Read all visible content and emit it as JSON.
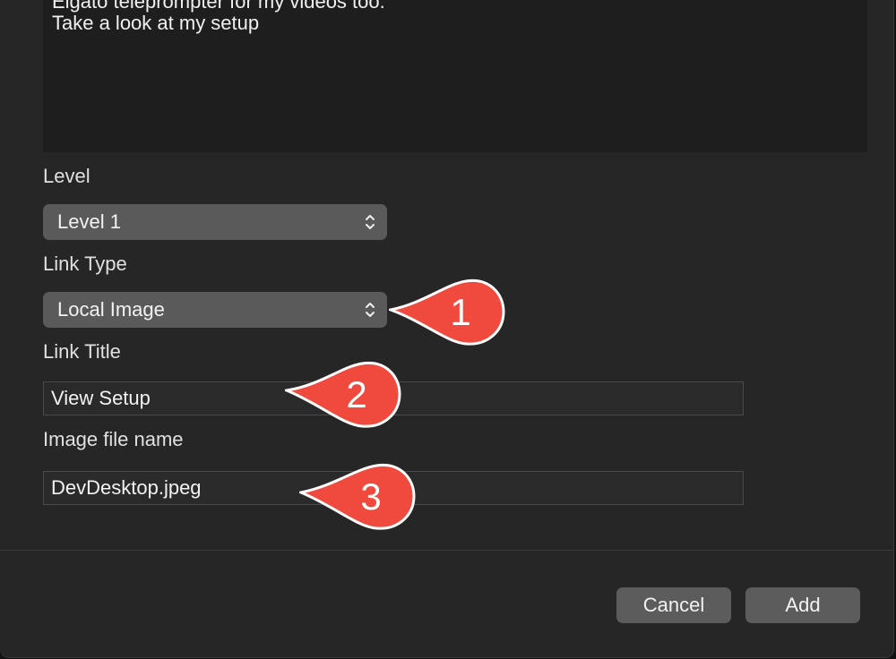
{
  "notes": {
    "lines": [
      "Elgato teleprompter for my videos too.",
      "Take a look at my setup"
    ]
  },
  "level": {
    "label": "Level",
    "selected": "Level 1"
  },
  "link_type": {
    "label": "Link Type",
    "selected": "Local Image"
  },
  "link_title": {
    "label": "Link Title",
    "value": "View Setup"
  },
  "image_file": {
    "label": "Image file name",
    "value": "DevDesktop.jpeg"
  },
  "buttons": {
    "cancel": "Cancel",
    "add": "Add"
  },
  "callouts": {
    "one": "1",
    "two": "2",
    "three": "3",
    "color": "#f04a3e"
  }
}
